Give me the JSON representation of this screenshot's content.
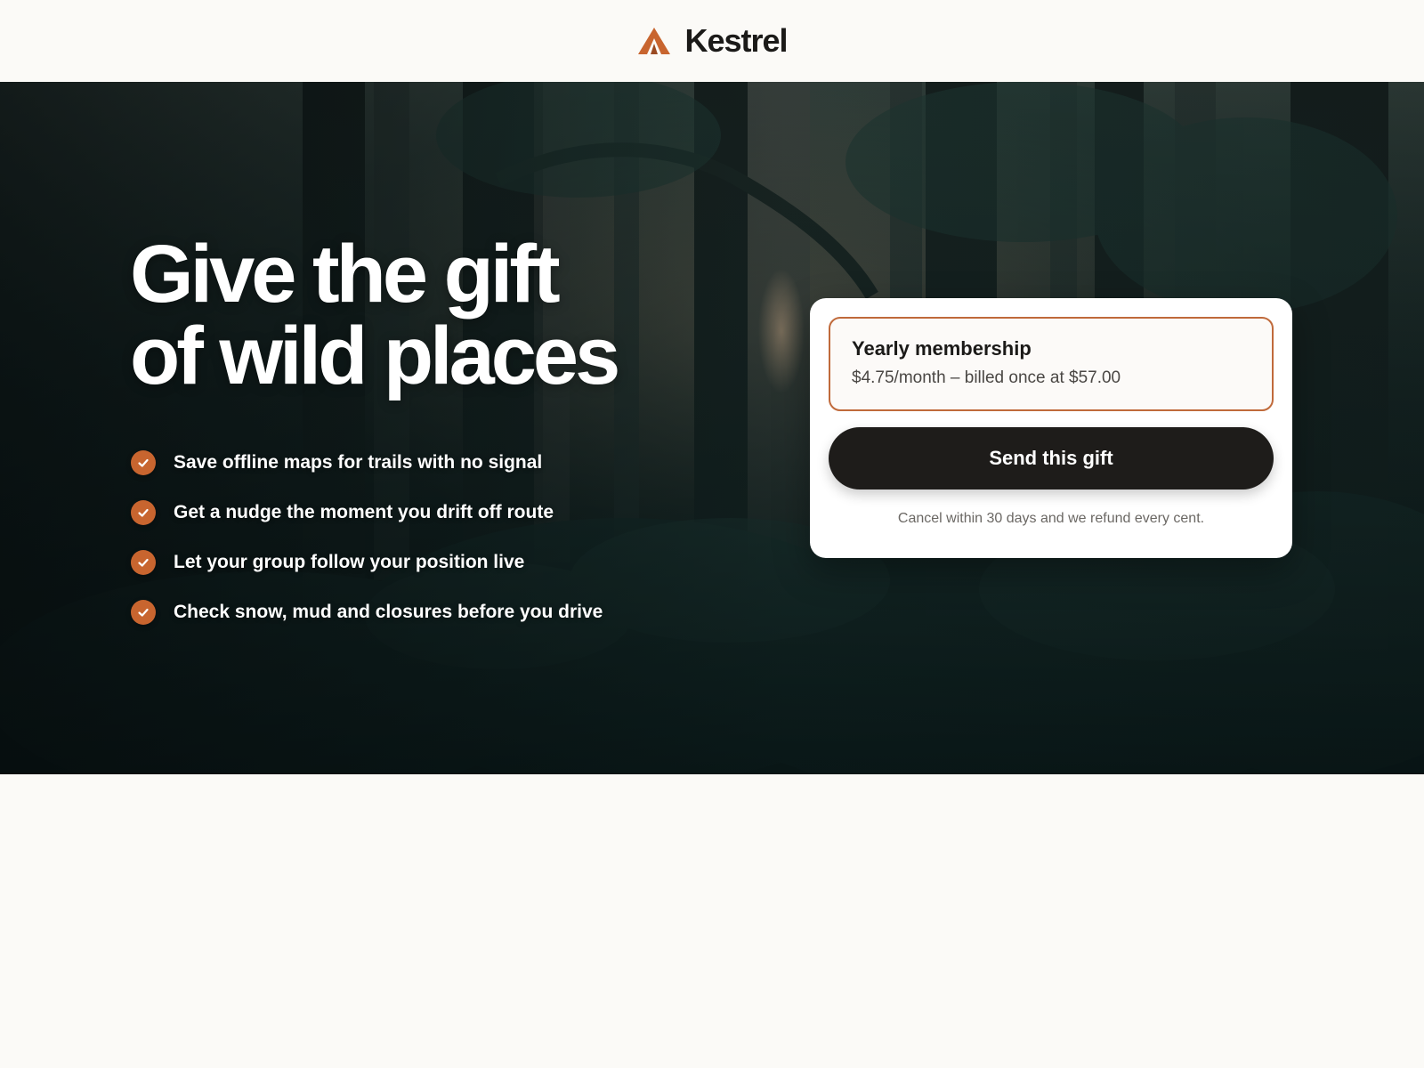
{
  "header": {
    "brand_name": "Kestrel",
    "logo_icon": "mountain-peak-logo",
    "accent_color": "#c8652f"
  },
  "hero": {
    "headline_line_1": "Give the gift",
    "headline_line_2": "of wild places",
    "background": "forest-photo",
    "features": [
      {
        "icon": "check-icon",
        "label": "Save offline maps for trails with no signal"
      },
      {
        "icon": "check-icon",
        "label": "Get a nudge the moment you drift off route"
      },
      {
        "icon": "check-icon",
        "label": "Let your group follow your position live"
      },
      {
        "icon": "check-icon",
        "label": "Check snow, mud and closures before you drive"
      }
    ]
  },
  "gift_card": {
    "plan_title": "Yearly membership",
    "plan_price": "$4.75/month – billed once at $57.00",
    "plan_selected": true,
    "cta_label": "Send this gift",
    "fine_print": "Cancel within 30 days and we refund every cent.",
    "border_color": "#c06a3b",
    "button_color": "#1e1c1a"
  }
}
